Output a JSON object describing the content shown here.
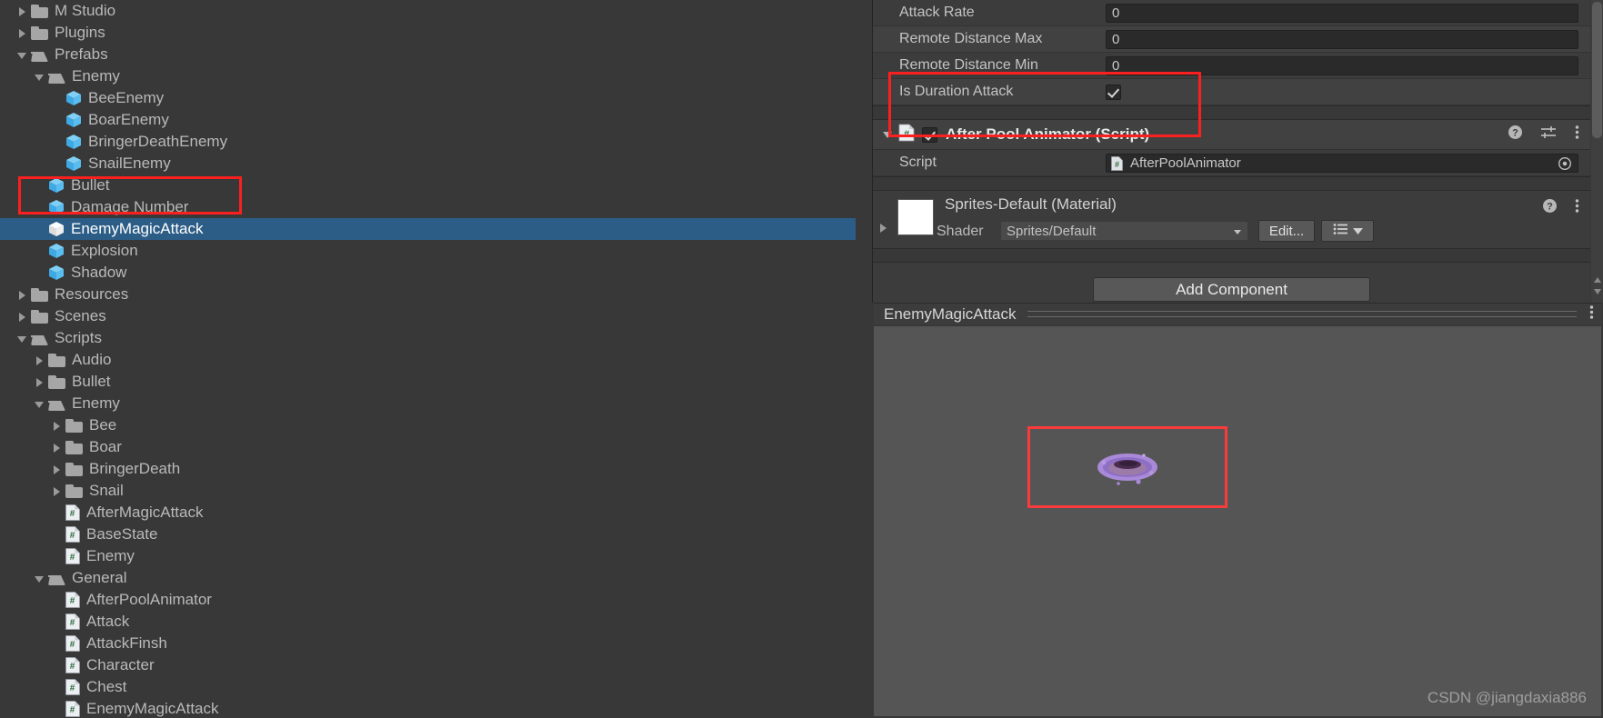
{
  "project_tree": {
    "panel_name": "Project",
    "items": [
      {
        "label": "M Studio",
        "indent": 0,
        "twisty": "closed",
        "icon": "folder-icon",
        "selected": false
      },
      {
        "label": "Plugins",
        "indent": 0,
        "twisty": "closed",
        "icon": "folder-icon",
        "selected": false
      },
      {
        "label": "Prefabs",
        "indent": 0,
        "twisty": "open",
        "icon": "folder-open-icon",
        "selected": false
      },
      {
        "label": "Enemy",
        "indent": 1,
        "twisty": "open",
        "icon": "folder-open-icon",
        "selected": false
      },
      {
        "label": "BeeEnemy",
        "indent": 2,
        "twisty": "none",
        "icon": "prefab-cube-icon",
        "selected": false
      },
      {
        "label": "BoarEnemy",
        "indent": 2,
        "twisty": "none",
        "icon": "prefab-cube-icon",
        "selected": false
      },
      {
        "label": "BringerDeathEnemy",
        "indent": 2,
        "twisty": "none",
        "icon": "prefab-cube-icon",
        "selected": false
      },
      {
        "label": "SnailEnemy",
        "indent": 2,
        "twisty": "none",
        "icon": "prefab-cube-icon",
        "selected": false
      },
      {
        "label": "Bullet",
        "indent": 1,
        "twisty": "none",
        "icon": "prefab-cube-icon",
        "selected": false
      },
      {
        "label": "Damage Number",
        "indent": 1,
        "twisty": "none",
        "icon": "prefab-cube-icon",
        "selected": false
      },
      {
        "label": "EnemyMagicAttack",
        "indent": 1,
        "twisty": "none",
        "icon": "prefab-cube-icon",
        "selected": true
      },
      {
        "label": "Explosion",
        "indent": 1,
        "twisty": "none",
        "icon": "prefab-cube-icon",
        "selected": false
      },
      {
        "label": "Shadow",
        "indent": 1,
        "twisty": "none",
        "icon": "prefab-cube-icon",
        "selected": false
      },
      {
        "label": "Resources",
        "indent": 0,
        "twisty": "closed",
        "icon": "folder-icon",
        "selected": false
      },
      {
        "label": "Scenes",
        "indent": 0,
        "twisty": "closed",
        "icon": "folder-icon",
        "selected": false
      },
      {
        "label": "Scripts",
        "indent": 0,
        "twisty": "open",
        "icon": "folder-open-icon",
        "selected": false
      },
      {
        "label": "Audio",
        "indent": 1,
        "twisty": "closed",
        "icon": "folder-icon",
        "selected": false
      },
      {
        "label": "Bullet",
        "indent": 1,
        "twisty": "closed",
        "icon": "folder-icon",
        "selected": false
      },
      {
        "label": "Enemy",
        "indent": 1,
        "twisty": "open",
        "icon": "folder-open-icon",
        "selected": false
      },
      {
        "label": "Bee",
        "indent": 2,
        "twisty": "closed",
        "icon": "folder-icon",
        "selected": false
      },
      {
        "label": "Boar",
        "indent": 2,
        "twisty": "closed",
        "icon": "folder-icon",
        "selected": false
      },
      {
        "label": "BringerDeath",
        "indent": 2,
        "twisty": "closed",
        "icon": "folder-icon",
        "selected": false
      },
      {
        "label": "Snail",
        "indent": 2,
        "twisty": "closed",
        "icon": "folder-icon",
        "selected": false
      },
      {
        "label": "AfterMagicAttack",
        "indent": 2,
        "twisty": "none",
        "icon": "csharp-script-icon",
        "selected": false
      },
      {
        "label": "BaseState",
        "indent": 2,
        "twisty": "none",
        "icon": "csharp-script-icon",
        "selected": false
      },
      {
        "label": "Enemy",
        "indent": 2,
        "twisty": "none",
        "icon": "csharp-script-icon",
        "selected": false
      },
      {
        "label": "General",
        "indent": 1,
        "twisty": "open",
        "icon": "folder-open-icon",
        "selected": false
      },
      {
        "label": "AfterPoolAnimator",
        "indent": 2,
        "twisty": "none",
        "icon": "csharp-script-icon",
        "selected": false
      },
      {
        "label": "Attack",
        "indent": 2,
        "twisty": "none",
        "icon": "csharp-script-icon",
        "selected": false
      },
      {
        "label": "AttackFinsh",
        "indent": 2,
        "twisty": "none",
        "icon": "csharp-script-icon",
        "selected": false
      },
      {
        "label": "Character",
        "indent": 2,
        "twisty": "none",
        "icon": "csharp-script-icon",
        "selected": false
      },
      {
        "label": "Chest",
        "indent": 2,
        "twisty": "none",
        "icon": "csharp-script-icon",
        "selected": false
      },
      {
        "label": "EnemyMagicAttack",
        "indent": 2,
        "twisty": "none",
        "icon": "csharp-script-icon",
        "selected": false
      }
    ]
  },
  "inspector": {
    "panel_name": "Inspector",
    "properties": [
      {
        "label": "Attack Rate",
        "type": "number",
        "value": "0"
      },
      {
        "label": "Remote Distance Max",
        "type": "number",
        "value": "0"
      },
      {
        "label": "Remote Distance Min",
        "type": "number",
        "value": "0"
      },
      {
        "label": "Is Duration Attack",
        "type": "checkbox",
        "value": "checked"
      }
    ],
    "script_component": {
      "title": "After Pool Animator (Script)",
      "enabled": true,
      "script_row_label": "Script",
      "script_row_value": "AfterPoolAnimator",
      "help_icon": "help-icon",
      "preset_icon": "preset-sliders-icon",
      "menu_icon": "kebab-menu-icon",
      "object_picker_icon": "object-picker-icon"
    },
    "material": {
      "name": "Sprites-Default (Material)",
      "shader_label": "Shader",
      "shader_value": "Sprites/Default",
      "edit_button": "Edit...",
      "help_icon": "help-icon",
      "menu_icon": "kebab-menu-icon",
      "list_icon": "shader-list-icon"
    },
    "add_component_button": "Add Component"
  },
  "preview": {
    "title": "EnemyMagicAttack",
    "menu_icon": "kebab-menu-icon",
    "watermark": "CSDN @jiangdaxia886"
  },
  "annotations": {
    "highlight_color": "#fb2020",
    "boxes": [
      {
        "name": "tree-selection-highlight",
        "target": "EnemyMagicAttack"
      },
      {
        "name": "script-component-highlight",
        "target": "After Pool Animator (Script)"
      },
      {
        "name": "preview-sprite-highlight",
        "target": "magic attack sprite"
      }
    ]
  },
  "colors": {
    "background": "#383838",
    "panel": "#3c3c3c",
    "selection_blue": "#2c5d87",
    "preview_bg": "#555555",
    "text": "#b9b9b9",
    "prefab_cube": "#55b7f0",
    "script_green": "#2c6a3f",
    "annotation_red": "#fb2020"
  }
}
